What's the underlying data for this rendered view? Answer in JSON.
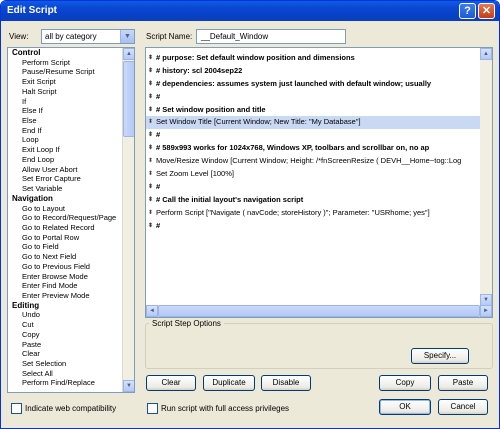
{
  "window": {
    "title": "Edit Script",
    "help_glyph": "?",
    "close_glyph": "✕"
  },
  "view": {
    "label": "View:",
    "selected": "all by category"
  },
  "script_name": {
    "label": "Script Name:",
    "value": "__Default_Window"
  },
  "steps": [
    {
      "label": "Control",
      "cat": true
    },
    {
      "label": "Perform Script"
    },
    {
      "label": "Pause/Resume Script"
    },
    {
      "label": "Exit Script"
    },
    {
      "label": "Halt Script"
    },
    {
      "label": "If"
    },
    {
      "label": "Else If"
    },
    {
      "label": "Else"
    },
    {
      "label": "End If"
    },
    {
      "label": "Loop"
    },
    {
      "label": "Exit Loop If"
    },
    {
      "label": "End Loop"
    },
    {
      "label": "Allow User Abort"
    },
    {
      "label": "Set Error Capture"
    },
    {
      "label": "Set Variable"
    },
    {
      "label": "Navigation",
      "cat": true
    },
    {
      "label": "Go to Layout"
    },
    {
      "label": "Go to Record/Request/Page"
    },
    {
      "label": "Go to Related Record"
    },
    {
      "label": "Go to Portal Row"
    },
    {
      "label": "Go to Field"
    },
    {
      "label": "Go to Next Field"
    },
    {
      "label": "Go to Previous Field"
    },
    {
      "label": "Enter Browse Mode"
    },
    {
      "label": "Enter Find Mode"
    },
    {
      "label": "Enter Preview Mode"
    },
    {
      "label": "Editing",
      "cat": true
    },
    {
      "label": "Undo"
    },
    {
      "label": "Cut"
    },
    {
      "label": "Copy"
    },
    {
      "label": "Paste"
    },
    {
      "label": "Clear"
    },
    {
      "label": "Set Selection"
    },
    {
      "label": "Select All"
    },
    {
      "label": "Perform Find/Replace"
    }
  ],
  "script_lines": [
    {
      "text": "#   purpose: Set default window position and dimensions",
      "comment": true
    },
    {
      "text": "#   history: scl 2004sep22",
      "comment": true
    },
    {
      "text": "#   dependencies: assumes system just launched with default window; usually",
      "comment": true
    },
    {
      "text": "#",
      "comment": true
    },
    {
      "text": "#   Set window position and title",
      "comment": true
    },
    {
      "text": "Set Window Title [Current Window; New Title: \"My Database\"]",
      "selected": true
    },
    {
      "text": "#",
      "comment": true
    },
    {
      "text": "#   589x993 works for 1024x768, Windows XP, toolbars and scrollbar on, no ap",
      "comment": true
    },
    {
      "text": "Move/Resize Window [Current Window; Height: /*fnScreenResize ( DEVH__Home~tog::Log"
    },
    {
      "text": "Set Zoom Level [100%]"
    },
    {
      "text": "#",
      "comment": true
    },
    {
      "text": "#   Call the initial layout's navigation script",
      "comment": true
    },
    {
      "text": "Perform Script [\"Navigate ( navCode; storeHistory )\"; Parameter: \"USRhome; yes\"]"
    },
    {
      "text": "#",
      "comment": true
    }
  ],
  "options": {
    "label": "Script Step Options",
    "specify": "Specify..."
  },
  "buttons": {
    "clear": "Clear",
    "duplicate": "Duplicate",
    "disable": "Disable",
    "copy": "Copy",
    "paste": "Paste",
    "ok": "OK",
    "cancel": "Cancel"
  },
  "checkboxes": {
    "web_compat": "Indicate web compatibility",
    "full_access": "Run script with full access privileges"
  },
  "icons": [
    "help-icon",
    "close-icon",
    "chevron-down-icon",
    "scroll-up-icon",
    "scroll-down-icon",
    "move-handle-icon"
  ]
}
